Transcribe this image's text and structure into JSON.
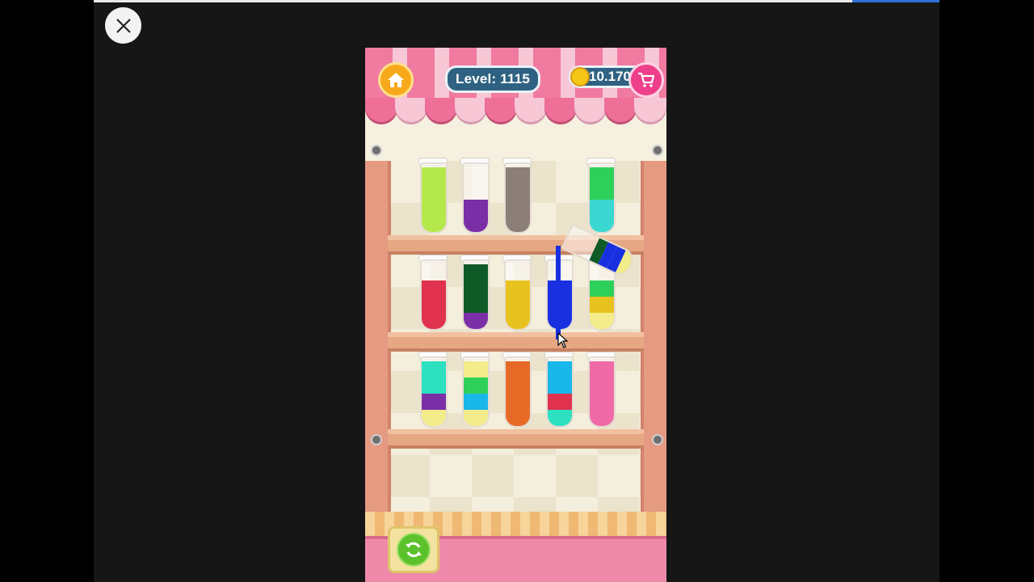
{
  "hud": {
    "level_text": "Level: 1115",
    "coins_text": "10.170"
  },
  "icons": {
    "close": "close-icon",
    "home": "home-icon",
    "coin": "coin-icon",
    "cart": "cart-icon",
    "restart": "restart-icon"
  },
  "colors": {
    "lime": "#b5e84b",
    "purple": "#7b2fa6",
    "taupe": "#8c7f78",
    "green": "#2fd05a",
    "cyan": "#3ad8d0",
    "red": "#e0324e",
    "darkgreen": "#0f5b28",
    "yellow": "#e8c21e",
    "blue": "#1830e0",
    "paleyellow": "#f3ec8a",
    "teal": "#2ce0c0",
    "skyblue": "#19b7ea",
    "orange": "#e66a26",
    "pink": "#ef6aa6"
  },
  "shelves": [
    {
      "tubes": [
        {
          "layers": [
            "lime",
            "lime",
            "lime",
            "lime"
          ]
        },
        {
          "layers": [
            "purple",
            "purple"
          ]
        },
        {
          "layers": [
            "taupe",
            "taupe",
            "taupe",
            "taupe"
          ]
        },
        {
          "layers": []
        },
        {
          "layers": [
            "cyan",
            "cyan",
            "green",
            "green"
          ]
        }
      ]
    },
    {
      "tubes": [
        {
          "layers": [
            "red",
            "red",
            "red"
          ]
        },
        {
          "layers": [
            "purple",
            "darkgreen",
            "darkgreen",
            "darkgreen"
          ]
        },
        {
          "layers": [
            "yellow",
            "yellow",
            "yellow"
          ]
        },
        {
          "layers": [
            "blue",
            "blue",
            "blue"
          ]
        },
        {
          "layers": [
            "paleyellow",
            "yellow",
            "green"
          ]
        }
      ]
    },
    {
      "tubes": [
        {
          "layers": [
            "paleyellow",
            "purple",
            "teal",
            "teal"
          ]
        },
        {
          "layers": [
            "paleyellow",
            "skyblue",
            "green",
            "paleyellow"
          ]
        },
        {
          "layers": [
            "orange",
            "orange",
            "orange",
            "orange"
          ]
        },
        {
          "layers": [
            "teal",
            "red",
            "skyblue",
            "skyblue"
          ]
        },
        {
          "layers": [
            "pink",
            "pink",
            "pink",
            "pink"
          ]
        }
      ]
    }
  ],
  "pouring_tube": {
    "layers": [
      "paleyellow",
      "blue",
      "blue",
      "darkgreen"
    ]
  }
}
